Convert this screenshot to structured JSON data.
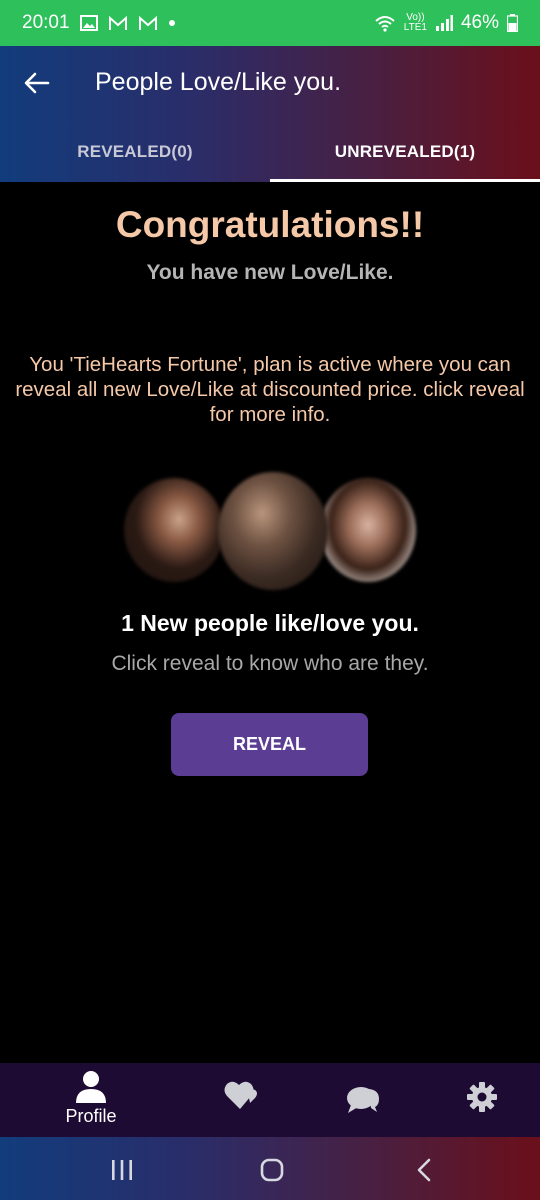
{
  "status_bar": {
    "time": "20:01",
    "lte_top": "Vo))",
    "lte_bottom": "LTE1",
    "battery": "46%"
  },
  "header": {
    "title": "People Love/Like you.",
    "tabs": [
      {
        "label": "REVEALED(0)",
        "active": false
      },
      {
        "label": "UNREVEALED(1)",
        "active": true
      }
    ]
  },
  "main": {
    "congrats": "Congratulations!!",
    "subtitle": "You have new Love/Like.",
    "plan_text": "You 'TieHearts Fortune', plan is active where you can reveal all new Love/Like at discounted price. click reveal for more info.",
    "new_people": "1 New people like/love you.",
    "click_reveal": "Click reveal to know who are they.",
    "reveal_button": "REVEAL"
  },
  "bottom_nav": {
    "profile_label": "Profile"
  },
  "colors": {
    "status_bar": "#2ec05a",
    "accent_peach": "#f5c8a8",
    "reveal_button": "#5b3d94",
    "bottom_nav": "#1e0b33"
  }
}
